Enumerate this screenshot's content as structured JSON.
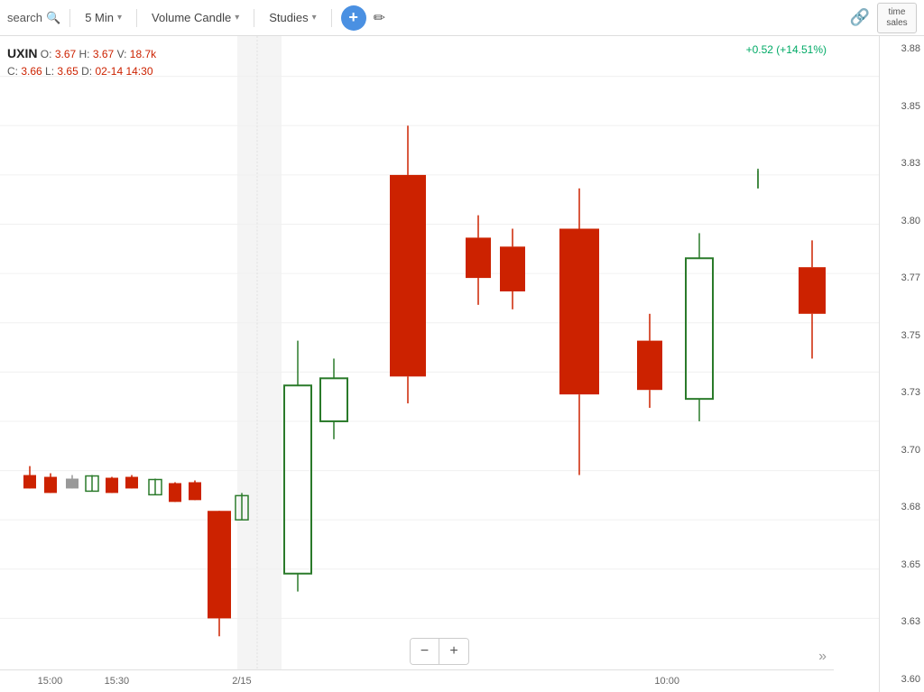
{
  "toolbar": {
    "search_label": "search",
    "timeframe_label": "5 Min",
    "chart_type_label": "Volume Candle",
    "studies_label": "Studies",
    "add_label": "+",
    "time_sales_label": "time\nsales"
  },
  "chart": {
    "ticker": "UXIN",
    "open": "3.67",
    "high": "3.67",
    "volume": "18.7k",
    "close": "3.66",
    "low": "3.65",
    "date": "02-14 14:30",
    "change": "+0.52 (+14.51%)",
    "price_labels": [
      "3.88",
      "3.85",
      "3.83",
      "3.80",
      "3.77",
      "3.75",
      "3.73",
      "3.70",
      "3.68",
      "3.65",
      "3.63",
      "3.60"
    ],
    "time_labels": [
      {
        "label": "15:00",
        "pct": 6
      },
      {
        "label": "15:30",
        "pct": 14
      },
      {
        "label": "2/15",
        "pct": 29
      },
      {
        "label": "10:00",
        "pct": 80
      }
    ]
  },
  "zoom": {
    "minus": "−",
    "plus": "+"
  },
  "icons": {
    "search": "🔍",
    "draw": "✏",
    "link": "🔗",
    "expand": "»"
  }
}
